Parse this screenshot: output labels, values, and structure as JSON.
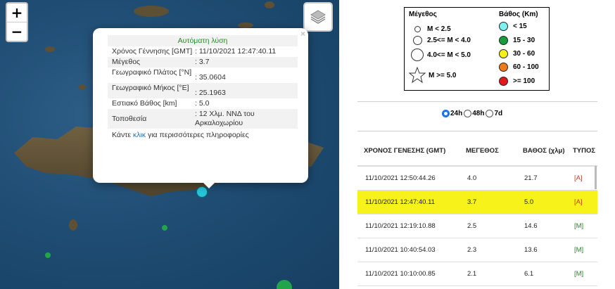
{
  "map": {
    "zoom_in": "+",
    "zoom_out": "−",
    "popup": {
      "title": "Αυτόματη λύση",
      "close": "×",
      "rows": [
        {
          "label": "Χρόνος Γέννησης [GMT]",
          "value": ": 11/10/2021 12:47:40.11"
        },
        {
          "label": "Μέγεθος",
          "value": ": 3.7"
        },
        {
          "label": "Γεωγραφικό Πλάτος [°N]",
          "value": ": 35.0604"
        },
        {
          "label": "Γεωγραφικό Μήκος [°E]",
          "value": ": 25.1963"
        },
        {
          "label": "Εστιακό Βάθος [km]",
          "value": ": 5.0"
        },
        {
          "label": "Τοποθεσία",
          "value": ": 12 Χλμ. ΝΝΔ του Αρκαλοχωρίου"
        }
      ],
      "footer_pre": "Κάντε ",
      "footer_link": "κλικ",
      "footer_post": " για περισσότερες πληροφορίες"
    },
    "colors": {
      "sea": "#1f4d74",
      "quake_shallow": "#26c6da",
      "quake_mid": "#21a44a"
    }
  },
  "legend": {
    "magnitude_title": "Μέγεθος",
    "depth_title": "Βάθος (Km)",
    "magnitudes": [
      "M < 2.5",
      "2.5<= M < 4.0",
      "4.0<= M < 5.0",
      "M >= 5.0"
    ],
    "depths": [
      {
        "label": "< 15",
        "color": "#7ff0f0"
      },
      {
        "label": "15 - 30",
        "color": "#1a9c3a"
      },
      {
        "label": "30 - 60",
        "color": "#f4f01a"
      },
      {
        "label": "60 - 100",
        "color": "#f07a1a"
      },
      {
        "label": ">= 100",
        "color": "#e01a1a"
      }
    ]
  },
  "filter": {
    "options": [
      "24h",
      "48h",
      "7d"
    ],
    "selected": "24h"
  },
  "table": {
    "headers": [
      "ΧΡΟΝΟΣ ΓΕΝΕΣΗΣ (GMT)",
      "ΜΕΓΕΘΟΣ",
      "ΒΑΘΟΣ (χλμ)",
      "ΤΥΠΟΣ"
    ],
    "rows": [
      {
        "time": "11/10/2021 12:50:44.26",
        "mag": "4.0",
        "depth": "21.7",
        "type": "[A]"
      },
      {
        "time": "11/10/2021 12:47:40.11",
        "mag": "3.7",
        "depth": "5.0",
        "type": "[A]"
      },
      {
        "time": "11/10/2021 12:19:10.88",
        "mag": "2.5",
        "depth": "14.6",
        "type": "[M]"
      },
      {
        "time": "11/10/2021 10:40:54.03",
        "mag": "2.3",
        "depth": "13.6",
        "type": "[M]"
      },
      {
        "time": "11/10/2021 10:10:00.85",
        "mag": "2.1",
        "depth": "6.1",
        "type": "[M]"
      }
    ],
    "highlight_row": 1
  }
}
